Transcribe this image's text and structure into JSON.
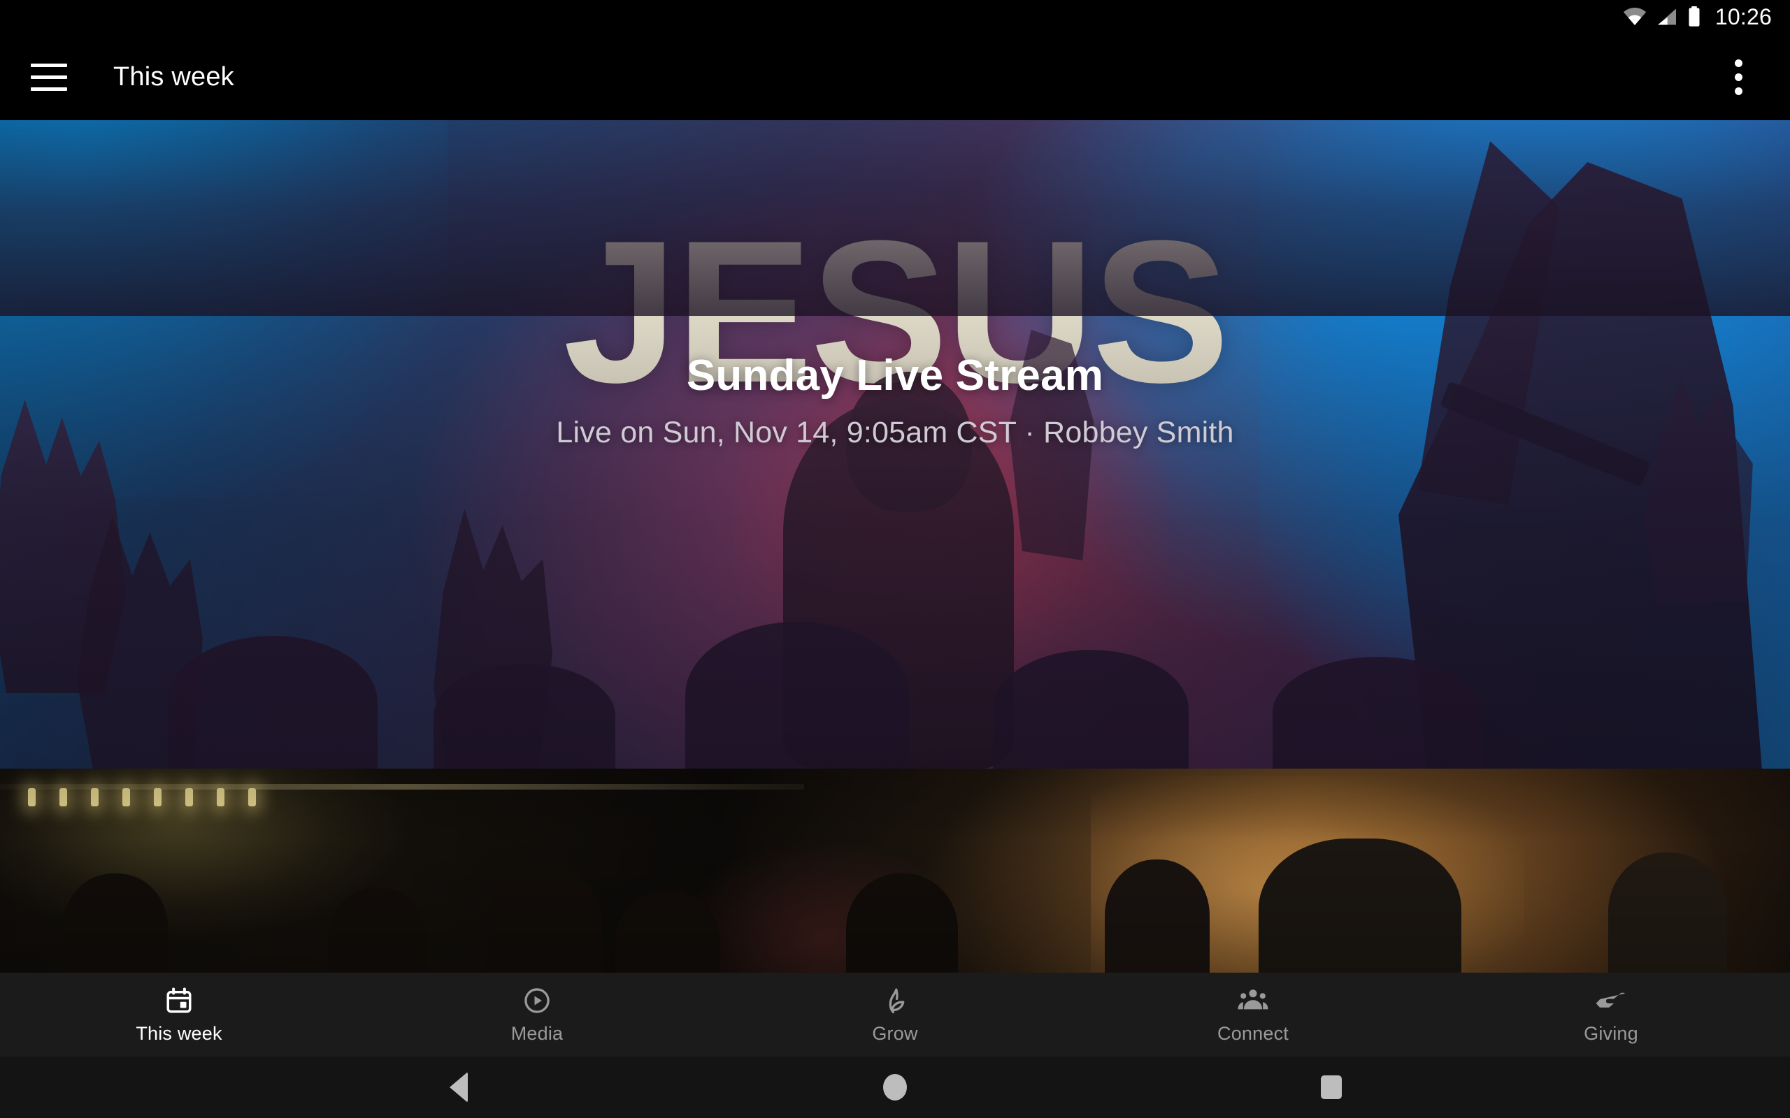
{
  "status_bar": {
    "time": "10:26",
    "icons": [
      "wifi-icon",
      "cellular-signal-icon",
      "battery-icon"
    ]
  },
  "app_bar": {
    "menu_icon": "hamburger-menu-icon",
    "title": "This week",
    "overflow_icon": "more-vertical-icon"
  },
  "hero_card": {
    "background_text": "JESUS",
    "title": "Sunday Live Stream",
    "subtitle": "Live on Sun, Nov 14, 9:05am CST · Robbey Smith"
  },
  "second_card": {
    "description": "night outdoor gathering photo"
  },
  "bottom_nav": {
    "items": [
      {
        "label": "This week",
        "icon": "calendar-icon",
        "active": true
      },
      {
        "label": "Media",
        "icon": "play-circle-icon",
        "active": false
      },
      {
        "label": "Grow",
        "icon": "sprout-leaf-icon",
        "active": false
      },
      {
        "label": "Connect",
        "icon": "people-group-icon",
        "active": false
      },
      {
        "label": "Giving",
        "icon": "giving-hand-icon",
        "active": false
      }
    ]
  },
  "system_nav": {
    "back": "back-triangle-icon",
    "home": "home-circle-icon",
    "recents": "recents-square-icon"
  },
  "colors": {
    "app_bar_bg": "#000000",
    "bottom_nav_bg": "#1b1b1b",
    "system_nav_bg": "#141414",
    "active_label": "#ffffff",
    "inactive_label": "#9a9a9a",
    "hero_title": "#ffffff",
    "hero_subtitle": "#cfcad4"
  }
}
